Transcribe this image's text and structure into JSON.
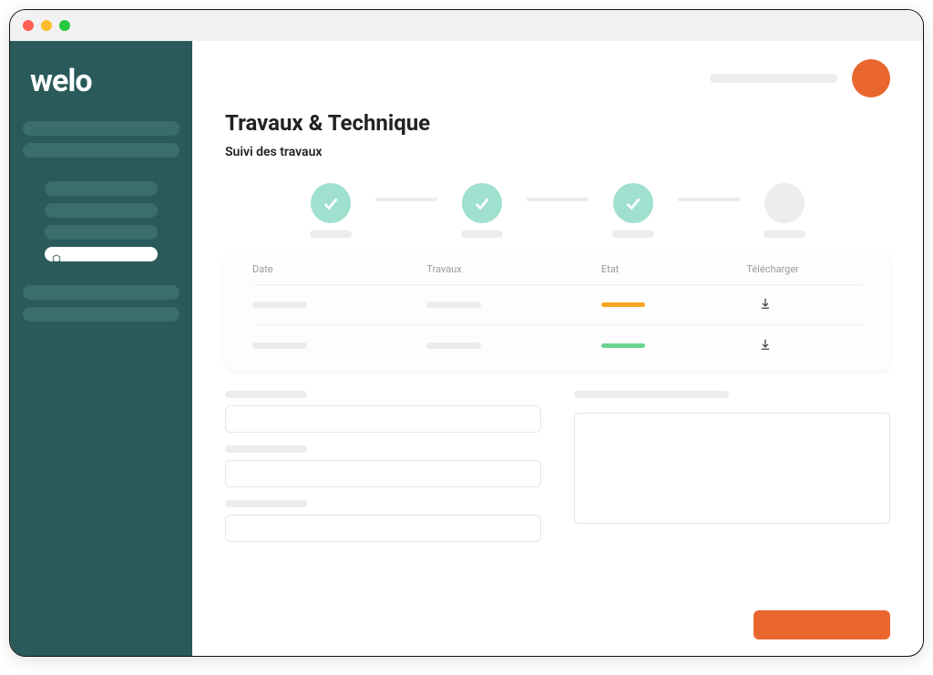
{
  "brand": {
    "logo_text": "welo"
  },
  "sidebar": {
    "items": [
      {
        "type": "group"
      },
      {
        "type": "group"
      },
      {
        "type": "sub"
      },
      {
        "type": "sub"
      },
      {
        "type": "sub"
      },
      {
        "type": "sub-active"
      },
      {
        "type": "group"
      },
      {
        "type": "group"
      }
    ]
  },
  "header": {
    "avatar_color": "#e9662f"
  },
  "page": {
    "title": "Travaux & Technique",
    "subtitle": "Suivi des travaux"
  },
  "stepper": {
    "steps": [
      {
        "state": "done"
      },
      {
        "state": "done"
      },
      {
        "state": "done"
      },
      {
        "state": "pending"
      }
    ]
  },
  "table": {
    "columns": {
      "date": "Date",
      "travaux": "Travaux",
      "etat": "Etat",
      "telecharger": "Télécharger"
    },
    "rows": [
      {
        "etat": "orange"
      },
      {
        "etat": "green"
      }
    ]
  },
  "forms": {
    "left_fields": [
      {},
      {},
      {}
    ],
    "right_field": {}
  },
  "actions": {
    "primary_color": "#e9662f"
  },
  "icons": {
    "check": "check",
    "download": "download",
    "hex": "hexagon"
  },
  "colors": {
    "sidebar": "#2a5a5a",
    "accent": "#e9662f",
    "step_done": "#9fe0cf",
    "status_inprogress": "#f5a623",
    "status_done": "#6cd28f"
  }
}
